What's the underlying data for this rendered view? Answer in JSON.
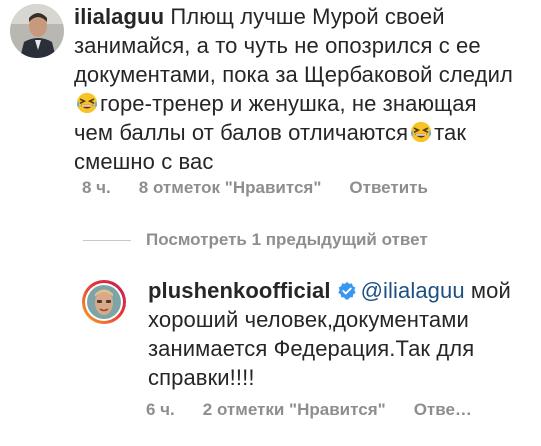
{
  "comment1": {
    "username": "ilialaguu",
    "text_part1": "Плющ лучше  Мурой своей занимайся, а то чуть не опозрился с ее документами, пока за Щербаковой следил",
    "text_part2": "горе-тренер и женушка, не знающая чем баллы от балов отличаются",
    "text_part3": "так смешно с вас",
    "emoji": "grinning-squinting-face-icon",
    "time": "8 ч.",
    "likes": "8 отметок \"Нравится\"",
    "reply_label": "Ответить"
  },
  "view_replies": {
    "label": "Посмотреть 1 предыдущий ответ"
  },
  "comment2": {
    "username": "plushenkoofficial",
    "mention": "@ilialaguu",
    "text": " мой хороший человек,документами занимается Федерация.Так для справки!!!!",
    "time": "6 ч.",
    "likes": "2 отметки \"Нравится\"",
    "reply_label": "Отве…",
    "verified_icon": "verified-badge-icon"
  },
  "colors": {
    "text": "#262626",
    "meta": "#8e8e8e",
    "mention": "#1d4f85",
    "verified": "#3897f0"
  }
}
